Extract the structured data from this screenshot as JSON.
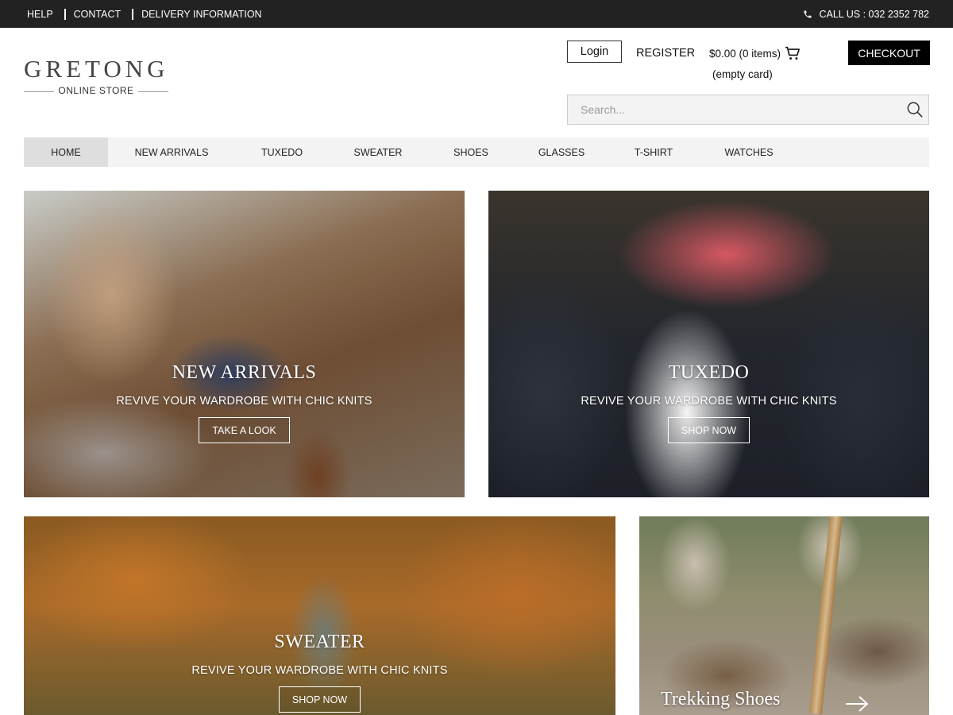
{
  "topbar": {
    "links": [
      "HELP",
      "CONTACT",
      "DELIVERY INFORMATION"
    ],
    "call": "CALL US : 032 2352 782",
    "call_icon": "phone-icon"
  },
  "header": {
    "logo_name": "GRETONG",
    "logo_sub": "ONLINE STORE",
    "login": "Login",
    "register": "REGISTER",
    "cart_total": "$0.00 (0 items)",
    "cart_empty": "(empty card)",
    "cart_icon": "cart-icon",
    "checkout": "CHECKOUT",
    "search_placeholder": "Search..."
  },
  "nav": {
    "items": [
      "HOME",
      "NEW ARRIVALS",
      "TUXEDO",
      "SWEATER",
      "SHOES",
      "GLASSES",
      "T-SHIRT",
      "WATCHES"
    ],
    "active": "HOME"
  },
  "banners": [
    {
      "title": "NEW ARRIVALS",
      "subtitle": "REVIVE YOUR WARDROBE WITH CHIC KNITS",
      "cta": "TAKE A LOOK"
    },
    {
      "title": "TUXEDO",
      "subtitle": "REVIVE YOUR WARDROBE WITH CHIC KNITS",
      "cta": "SHOP NOW"
    },
    {
      "title": "SWEATER",
      "subtitle": "REVIVE YOUR WARDROBE WITH CHIC KNITS",
      "cta": "SHOP NOW"
    },
    {
      "title": "Trekking Shoes",
      "icon": "arrow-right-icon"
    }
  ]
}
